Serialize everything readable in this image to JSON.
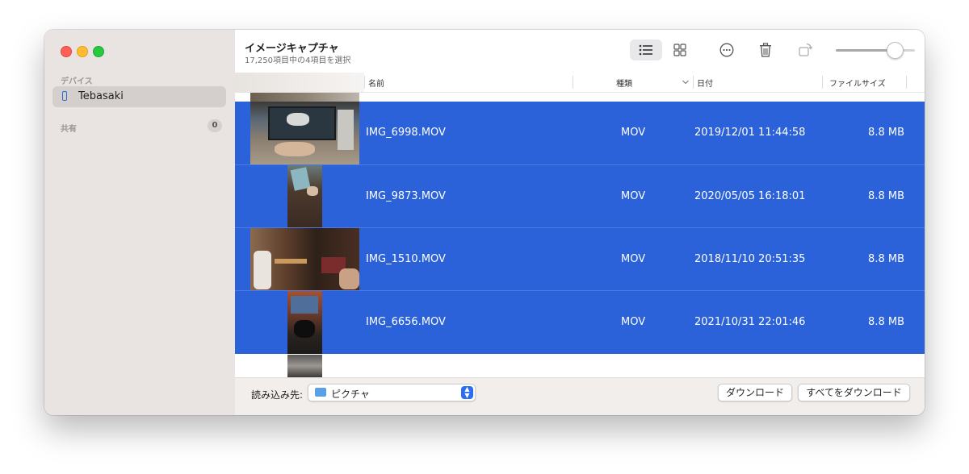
{
  "sidebar": {
    "section_devices": "デバイス",
    "device_name": "Tebasaki",
    "section_shared": "共有",
    "shared_count": "0"
  },
  "header": {
    "title": "イメージキャプチャ",
    "subtitle": "17,250項目中の4項目を選択"
  },
  "toolbar": {
    "list_view_icon": "list-icon",
    "grid_view_icon": "grid-icon",
    "more_icon": "ellipsis-circle-icon",
    "delete_icon": "trash-icon",
    "rotate_icon": "rotate-icon",
    "thumbnail_size": 0.75
  },
  "columns": {
    "name": "名前",
    "kind": "種類",
    "date": "日付",
    "size": "ファイルサイズ"
  },
  "rows": [
    {
      "name": "IMG_6998.MOV",
      "kind": "MOV",
      "date": "2019/12/01 11:44:58",
      "size": "8.8 MB"
    },
    {
      "name": "IMG_9873.MOV",
      "kind": "MOV",
      "date": "2020/05/05 16:18:01",
      "size": "8.8 MB"
    },
    {
      "name": "IMG_1510.MOV",
      "kind": "MOV",
      "date": "2018/11/10 20:51:35",
      "size": "8.8 MB"
    },
    {
      "name": "IMG_6656.MOV",
      "kind": "MOV",
      "date": "2021/10/31 22:01:46",
      "size": "8.8 MB"
    }
  ],
  "footer": {
    "import_to_label": "読み込み先:",
    "import_to_value": "ピクチャ",
    "download_button": "ダウンロード",
    "download_all_button": "すべてをダウンロード"
  },
  "colors": {
    "selection": "#2b62d9",
    "sidebar_bg": "#e9e4e1",
    "accent": "#1f6fe0"
  }
}
